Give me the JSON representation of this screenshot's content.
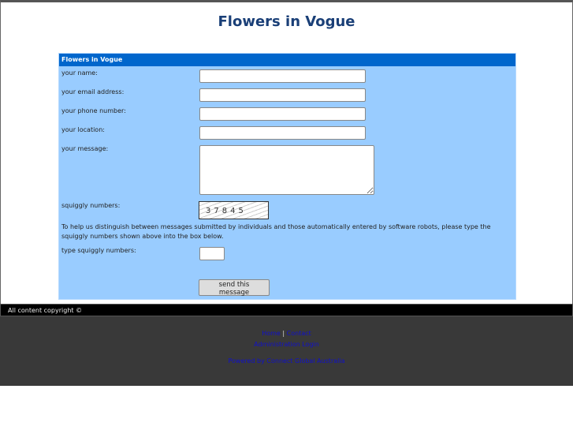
{
  "title": "Flowers in Vogue",
  "form": {
    "header": "Flowers in Vogue",
    "fields": [
      {
        "label": "your name:",
        "value": ""
      },
      {
        "label": "your email address:",
        "value": ""
      },
      {
        "label": "your phone number:",
        "value": ""
      },
      {
        "label": "your location:",
        "value": ""
      },
      {
        "label": "your message:",
        "value": ""
      }
    ],
    "captcha_label": "squiggly numbers:",
    "captcha_text": "37845",
    "help": "To help us distinguish between messages submitted by individuals and those automatically entered by software robots, please type the squiggly numbers shown above into the box below.",
    "type_label": "type squiggly numbers:",
    "submit": "send this message"
  },
  "copyright": "All content copyright ©",
  "footer": {
    "home": "Home",
    "sep": "|",
    "contact": "Contact",
    "admin": "Administration Login",
    "powered": "Powered by Connect Global Australia"
  }
}
